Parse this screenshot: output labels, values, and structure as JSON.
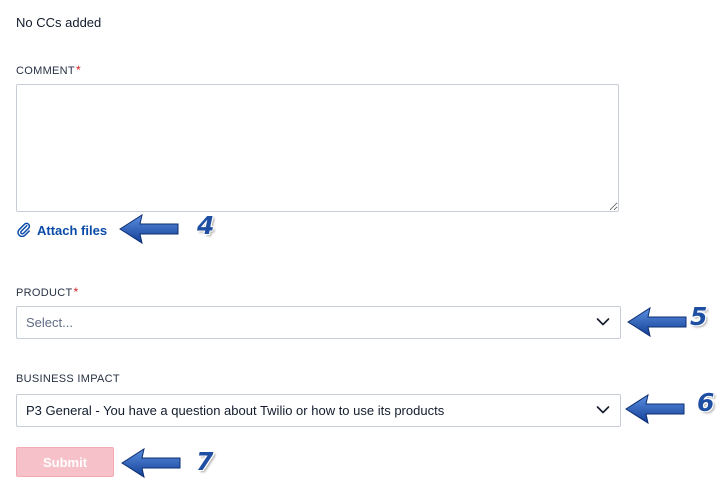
{
  "cc": {
    "empty_text": "No CCs added"
  },
  "comment": {
    "label": "COMMENT",
    "required_mark": "*",
    "value": ""
  },
  "attach": {
    "label": "Attach files",
    "icon": "paperclip-icon"
  },
  "product": {
    "label": "PRODUCT",
    "required_mark": "*",
    "selected": "Select..."
  },
  "business_impact": {
    "label": "BUSINESS IMPACT",
    "selected": "P3 General - You have a question about Twilio or how to use its products"
  },
  "submit": {
    "label": "Submit"
  },
  "annotations": [
    {
      "number": "4"
    },
    {
      "number": "5"
    },
    {
      "number": "6"
    },
    {
      "number": "7"
    }
  ],
  "colors": {
    "link": "#0b4ba8",
    "required": "#d61f1f",
    "submit_disabled_bg": "#f6c1c8",
    "annotation_arrow": "#1f4fa3"
  }
}
